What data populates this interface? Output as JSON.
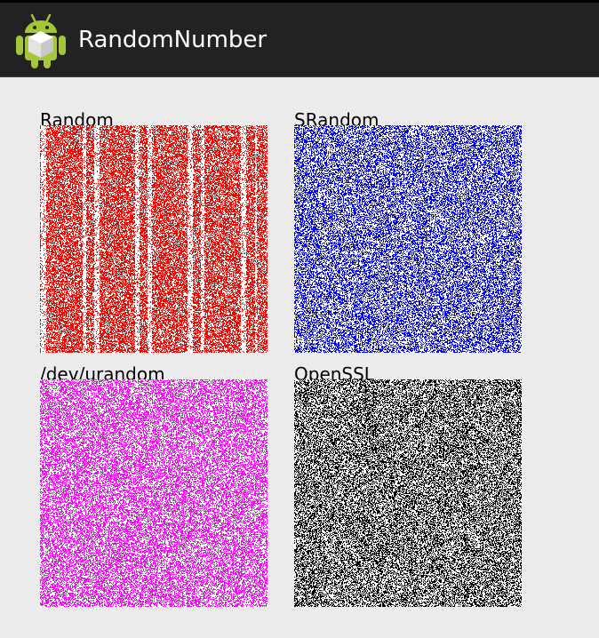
{
  "app": {
    "title": "RandomNumber",
    "icon": "android-robot-icon"
  },
  "panels": [
    {
      "label": "Random",
      "color": "#ff0000"
    },
    {
      "label": "SRandom",
      "color": "#0000ff"
    },
    {
      "label": "/dev/urandom",
      "color": "#ff00ff"
    },
    {
      "label": "OpenSSL",
      "color": "#000000"
    }
  ]
}
